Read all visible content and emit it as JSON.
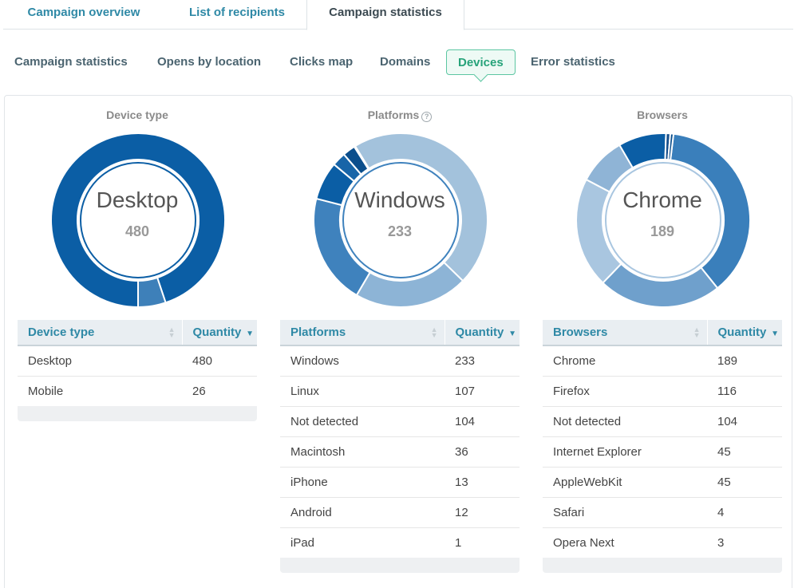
{
  "top_tabs": [
    "Campaign overview",
    "List of recipients",
    "Campaign statistics"
  ],
  "sub_tabs": [
    "Campaign statistics",
    "Opens by location",
    "Clicks map",
    "Domains",
    "Devices",
    "Error statistics"
  ],
  "help_icon": "?",
  "quantity_header": "Quantity",
  "chart_data": [
    {
      "type": "pie",
      "title": "Device type",
      "center_label": "Desktop",
      "center_value": "480",
      "categories": [
        "Desktop",
        "Mobile"
      ],
      "values": [
        480,
        26
      ]
    },
    {
      "type": "pie",
      "title": "Platforms",
      "center_label": "Windows",
      "center_value": "233",
      "categories": [
        "Windows",
        "Linux",
        "Not detected",
        "Macintosh",
        "iPhone",
        "Android",
        "iPad"
      ],
      "values": [
        233,
        107,
        104,
        36,
        13,
        12,
        1
      ]
    },
    {
      "type": "pie",
      "title": "Browsers",
      "center_label": "Chrome",
      "center_value": "189",
      "categories": [
        "Chrome",
        "Firefox",
        "Not detected",
        "Internet Explorer",
        "AppleWebKit",
        "Safari",
        "Opera Next"
      ],
      "values": [
        189,
        116,
        104,
        45,
        45,
        4,
        3
      ]
    }
  ],
  "colors": {
    "desktop": "#0b5ea5",
    "mobile": "#3e80b9",
    "platforms": [
      "#a3c2dc",
      "#8db4d6",
      "#3f82bd",
      "#0b5ea5",
      "#1865a8",
      "#0b4e8c",
      "#b7d0e6"
    ],
    "browsers": [
      "#3a7fbb",
      "#6fa0cc",
      "#a9c6e0",
      "#8fb4d6",
      "#0b5ea5",
      "#154f8c",
      "#0b4e8c"
    ]
  }
}
